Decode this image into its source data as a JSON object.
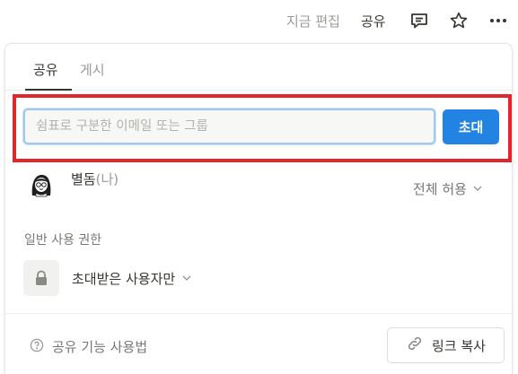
{
  "topbar": {
    "edited_label": "지금 편집",
    "share_label": "공유",
    "icons": [
      "comment-icon",
      "star-icon",
      "more-icon"
    ]
  },
  "share_panel": {
    "tabs": [
      {
        "label": "공유",
        "active": true
      },
      {
        "label": "게시",
        "active": false
      }
    ],
    "invite": {
      "placeholder": "쉼표로 구분한 이메일 또는 그룹",
      "value": "",
      "button_label": "초대"
    },
    "members": [
      {
        "name": "별돔",
        "me_tag": "(나)",
        "permission": "전체 허용"
      }
    ],
    "general_access": {
      "section_label": "일반 사용 권한",
      "selected": "초대받은 사용자만"
    },
    "footer": {
      "help_label": "공유 기능 사용법",
      "copy_link_label": "링크 복사"
    }
  },
  "colors": {
    "accent": "#2383e2",
    "highlight": "#e3262b",
    "text": "#37352f",
    "muted": "#9b9a97"
  }
}
